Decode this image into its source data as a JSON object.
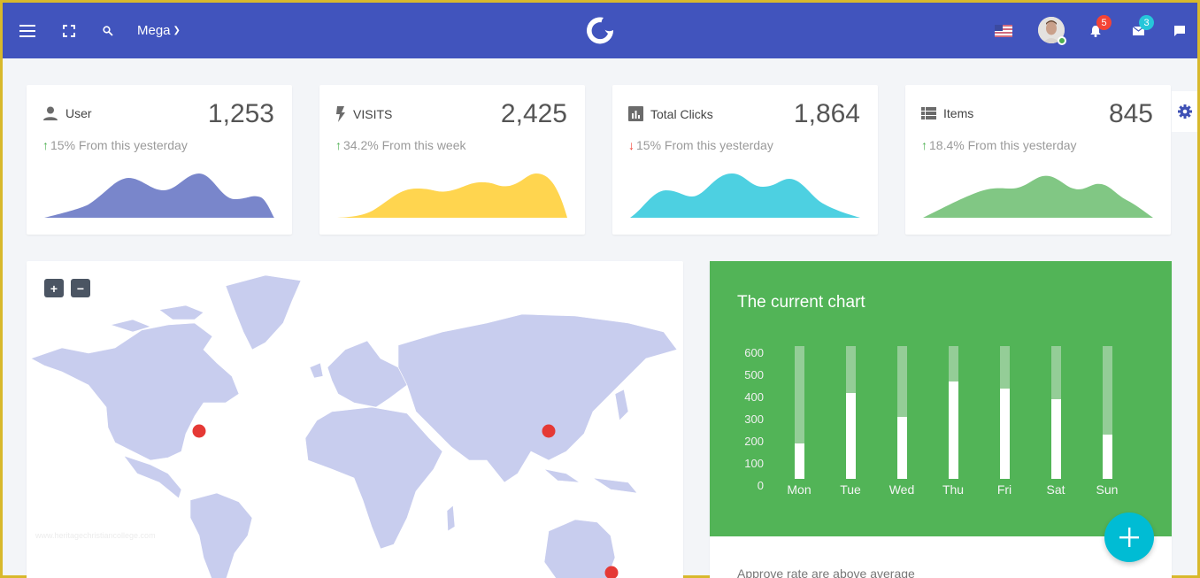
{
  "topbar": {
    "menu_icon": "hamburger-icon",
    "fullscreen_icon": "fullscreen-icon",
    "search_icon": "search-icon",
    "mega_label": "Mega",
    "logo_icon": "moon-logo-icon",
    "language_icon": "us-flag-icon",
    "notifications_count": "5",
    "messages_count": "3",
    "chat_icon": "chat-icon",
    "colors": {
      "bar": "#4154bd",
      "notif_badge": "#f44336",
      "msg_badge": "#26c6da"
    }
  },
  "stats": [
    {
      "label": "User",
      "value": "1,253",
      "delta": "15% From this yesterday",
      "direction": "up",
      "icon": "person-icon",
      "color": "#7986cb"
    },
    {
      "label": "VISITS",
      "value": "2,425",
      "delta": "34.2% From this week",
      "direction": "up",
      "icon": "bolt-icon",
      "color": "#ffd54f"
    },
    {
      "label": "Total Clicks",
      "value": "1,864",
      "delta": "15% From this yesterday",
      "direction": "down",
      "icon": "bar-chart-icon",
      "color": "#4dd0e1"
    },
    {
      "label": "Items",
      "value": "845",
      "delta": "18.4% From this yesterday",
      "direction": "up",
      "icon": "list-icon",
      "color": "#81c784"
    }
  ],
  "map": {
    "zoom_in": "+",
    "zoom_out": "−",
    "watermark": "www.heritagechristiancollege.com",
    "markers": [
      "New York",
      "Beijing",
      "Sydney"
    ]
  },
  "chart_data": {
    "type": "bar",
    "title": "The current chart",
    "categories": [
      "Mon",
      "Tue",
      "Wed",
      "Thu",
      "Fri",
      "Sat",
      "Sun"
    ],
    "series": [
      {
        "name": "value",
        "values": [
          160,
          390,
          280,
          440,
          410,
          360,
          200
        ]
      },
      {
        "name": "max",
        "values": [
          600,
          600,
          600,
          600,
          600,
          600,
          600
        ]
      }
    ],
    "yticks": [
      "600",
      "500",
      "400",
      "300",
      "200",
      "100",
      "0"
    ],
    "ylim": [
      0,
      600
    ],
    "xlabel": "",
    "ylabel": "",
    "grid": false
  },
  "chart_footer": "Approve rate are above average",
  "fab_label": "+"
}
